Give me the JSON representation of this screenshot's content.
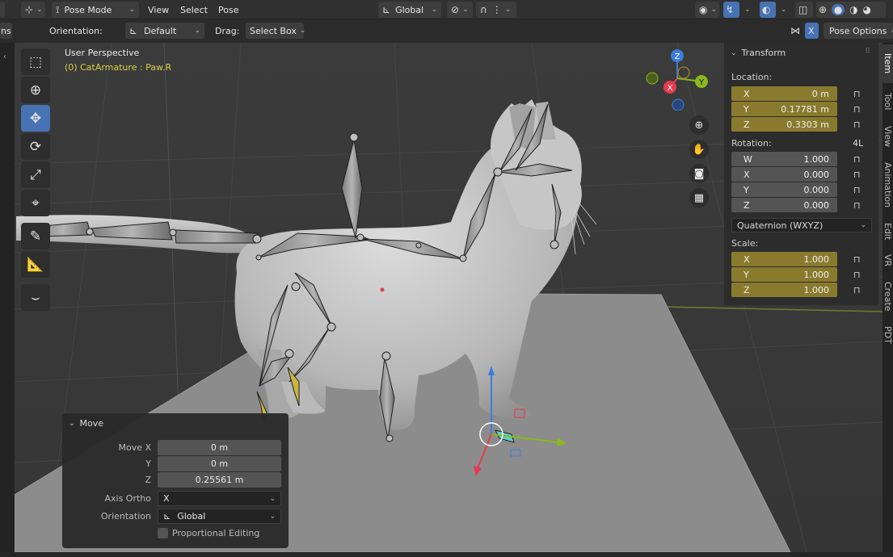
{
  "header": {
    "mode_label": "Pose Mode",
    "menus": [
      "View",
      "Select",
      "Pose"
    ],
    "transform_orientation": "Global",
    "left_cut_label": "ns"
  },
  "tool_header": {
    "orientation_label": "Orientation:",
    "orientation_value": "Default",
    "drag_label": "Drag:",
    "drag_value": "Select Box",
    "x_toggle": "X",
    "pose_options": "Pose Options"
  },
  "viewport": {
    "perspective_label": "User Perspective",
    "object_label": "(0) CatArmature : Paw.R",
    "gizmo": {
      "z": "Z",
      "x": "X",
      "y": "Y"
    }
  },
  "npanel": {
    "section_title": "Transform",
    "location_label": "Location:",
    "location": [
      {
        "axis": "X",
        "value": "0 m"
      },
      {
        "axis": "Y",
        "value": "0.17781 m"
      },
      {
        "axis": "Z",
        "value": "0.3303 m"
      }
    ],
    "rotation_label": "Rotation:",
    "rotation_extra": "4L",
    "rotation": [
      {
        "axis": "W",
        "value": "1.000"
      },
      {
        "axis": "X",
        "value": "0.000"
      },
      {
        "axis": "Y",
        "value": "0.000"
      },
      {
        "axis": "Z",
        "value": "0.000"
      }
    ],
    "rotation_mode": "Quaternion (WXYZ)",
    "scale_label": "Scale:",
    "scale": [
      {
        "axis": "X",
        "value": "1.000"
      },
      {
        "axis": "Y",
        "value": "1.000"
      },
      {
        "axis": "Z",
        "value": "1.000"
      }
    ]
  },
  "sidetabs": [
    "Item",
    "Tool",
    "View",
    "Animation",
    "Edit",
    "VR",
    "Create",
    "PDT"
  ],
  "last_operator": {
    "title": "Move",
    "move_x_label": "Move X",
    "move_x": "0 m",
    "y_label": "Y",
    "move_y": "0 m",
    "z_label": "Z",
    "move_z": "0.25561 m",
    "axis_ortho_label": "Axis Ortho",
    "axis_ortho_value": "X",
    "orientation_label": "Orientation",
    "orientation_value": "Global",
    "proportional_label": "Proportional Editing"
  },
  "colors": {
    "active_blue": "#4772b3",
    "field_gold": "#8a7a2e",
    "axis_x": "#e63b4e",
    "axis_y": "#8ab91c",
    "axis_z": "#3c7ddc",
    "active_bone": "#c9b640"
  }
}
